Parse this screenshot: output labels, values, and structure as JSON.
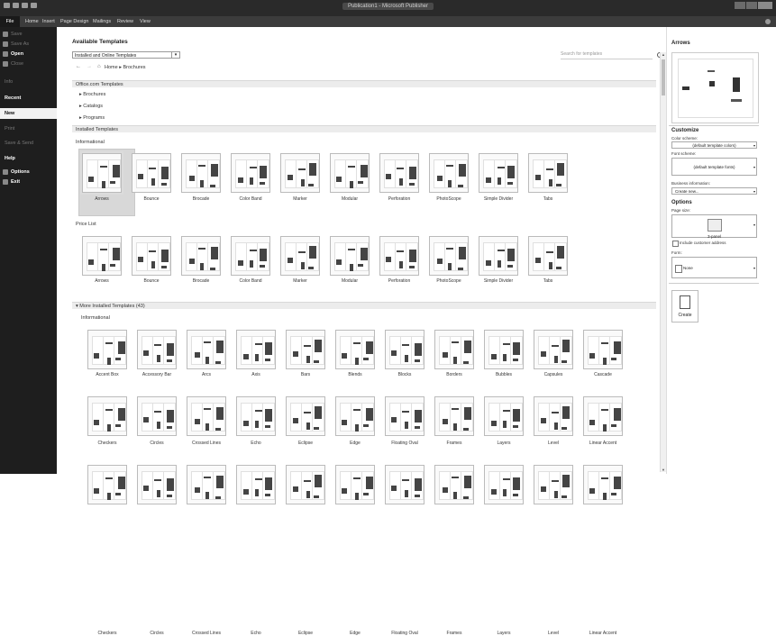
{
  "window": {
    "title": "Publication1 - Microsoft Publisher"
  },
  "menu": {
    "tabs": [
      {
        "label": "File",
        "name": "tab-file"
      },
      {
        "label": "Home",
        "name": "tab-home"
      },
      {
        "label": "Insert",
        "name": "tab-insert"
      },
      {
        "label": "Page Design",
        "name": "tab-page-design"
      },
      {
        "label": "Mailings",
        "name": "tab-mailings"
      },
      {
        "label": "Review",
        "name": "tab-review"
      },
      {
        "label": "View",
        "name": "tab-view"
      }
    ]
  },
  "backstage": {
    "items": [
      {
        "label": "Save",
        "icon": "save-icon",
        "style": "dim"
      },
      {
        "label": "Save As",
        "icon": "save-as-icon",
        "style": "dim"
      },
      {
        "label": "Open",
        "icon": "open-icon",
        "style": "bold"
      },
      {
        "label": "Close",
        "icon": "close-file-icon",
        "style": "dim"
      },
      {
        "label": "Info",
        "style": "dim"
      },
      {
        "label": "Recent",
        "style": "bold"
      },
      {
        "label": "New",
        "style": "active"
      },
      {
        "label": "Print",
        "style": "dim"
      },
      {
        "label": "Save & Send",
        "style": "dim"
      },
      {
        "label": "Help",
        "style": "bold"
      },
      {
        "label": "Options",
        "icon": "options-icon",
        "style": "bold"
      },
      {
        "label": "Exit",
        "icon": "exit-icon",
        "style": "bold"
      }
    ]
  },
  "main": {
    "title": "Available Templates",
    "source_select": "Installed and Online Templates",
    "search_placeholder": "Search for templates",
    "breadcrumb": "Home ▸ Brochures",
    "online_section": "Office.com Templates",
    "online_items": [
      "Brochures",
      "Catalogs",
      "Programs"
    ],
    "installed_section": "Installed Templates",
    "group1_label": "Informational",
    "group2_label": "Price List",
    "more_section": "More Installed Templates (43)",
    "group3_label": "Informational",
    "row_templates": [
      "Arrows",
      "Bounce",
      "Brocade",
      "Color Band",
      "Marker",
      "Modular",
      "Perforation",
      "PhotoScope",
      "Simple Divider",
      "Tabs"
    ],
    "more_row1": [
      "Accent Box",
      "Accessory Bar",
      "Arcs",
      "Axis",
      "Bars",
      "Blends",
      "Blocks",
      "Borders",
      "Bubbles",
      "Capsules",
      "Cascade"
    ],
    "more_row2": [
      "Checkers",
      "Circles",
      "Crossed Lines",
      "Echo",
      "Eclipse",
      "Edge",
      "Floating Oval",
      "Frames",
      "Layers",
      "Level",
      "Linear Accent"
    ]
  },
  "right_panel": {
    "title": "Arrows",
    "customize_title": "Customize",
    "color_scheme_label": "Color scheme:",
    "color_scheme_value": "(default template colors)",
    "font_scheme_label": "Font scheme:",
    "font_scheme_value": "(default template fonts)",
    "business_info_label": "Business information:",
    "business_info_value": "Create new...",
    "options_title": "Options",
    "page_size_label": "Page size:",
    "page_size_value": "3-panel",
    "include_address_label": "Include customer address",
    "form_label": "Form:",
    "form_value": "None",
    "create_label": "Create"
  }
}
